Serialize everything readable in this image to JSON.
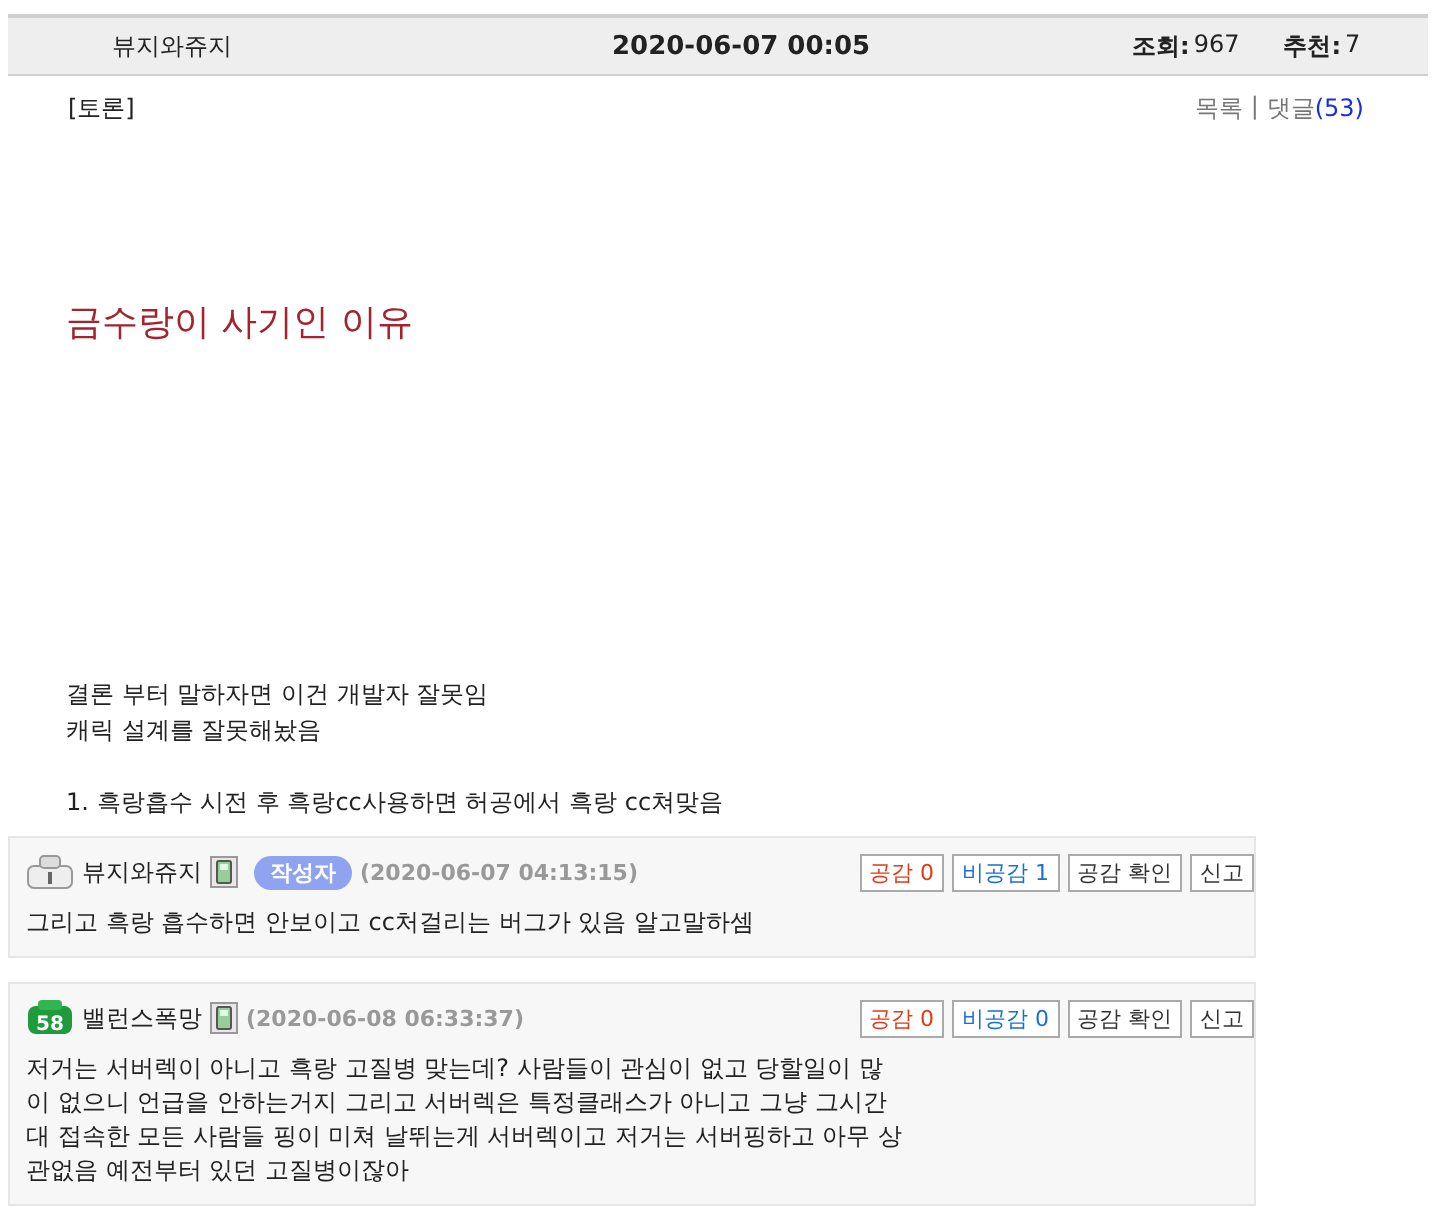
{
  "header": {
    "author": "뷰지와쥬지",
    "datetime": "2020-06-07 00:05",
    "views_label": "조회:",
    "views": "967",
    "recommend_label": "추천:",
    "recommend": "7"
  },
  "category": "[토론]",
  "nav": {
    "list_link": "목록",
    "separator": "|",
    "comments_link": "댓글",
    "comments_count": "(53)"
  },
  "title": "금수랑이 사기인 이유",
  "body": [
    [
      "결론 부터 말하자면 이건 개발자 잘못임",
      "캐릭 설계를 잘못해놨음"
    ],
    [
      "1. 흑랑흡수 시전 후 흑랑cc사용하면 허공에서 흑랑 cc쳐맞음"
    ]
  ],
  "comments": [
    {
      "kind": "basic",
      "name": "뷰지와쥬지",
      "is_author": true,
      "author_badge": "작성자",
      "date": "(2020-06-07 04:13:15)",
      "like": "공감 0",
      "dislike": "비공감 1",
      "check": "공감 확인",
      "report": "신고",
      "text": "그리고 흑랑 흡수하면 안보이고 cc처걸리는 버그가 있음 알고말하셈"
    },
    {
      "kind": "green",
      "level_text": "58",
      "name": "밸런스폭망",
      "is_author": false,
      "date": "(2020-06-08 06:33:37)",
      "like": "공감 0",
      "dislike": "비공감 0",
      "check": "공감 확인",
      "report": "신고",
      "text": "저거는 서버렉이 아니고 흑랑 고질병 맞는데? 사람들이 관심이 없고 당할일이 많\n이 없으니 언급을 안하는거지 그리고 서버렉은 특정클래스가 아니고 그냥 그시간\n대 접속한 모든 사람들 핑이 미쳐 날뛰는게 서버렉이고 저거는 서버핑하고 아무 상\n관없음 예전부터 있던 고질병이잖아"
    }
  ]
}
